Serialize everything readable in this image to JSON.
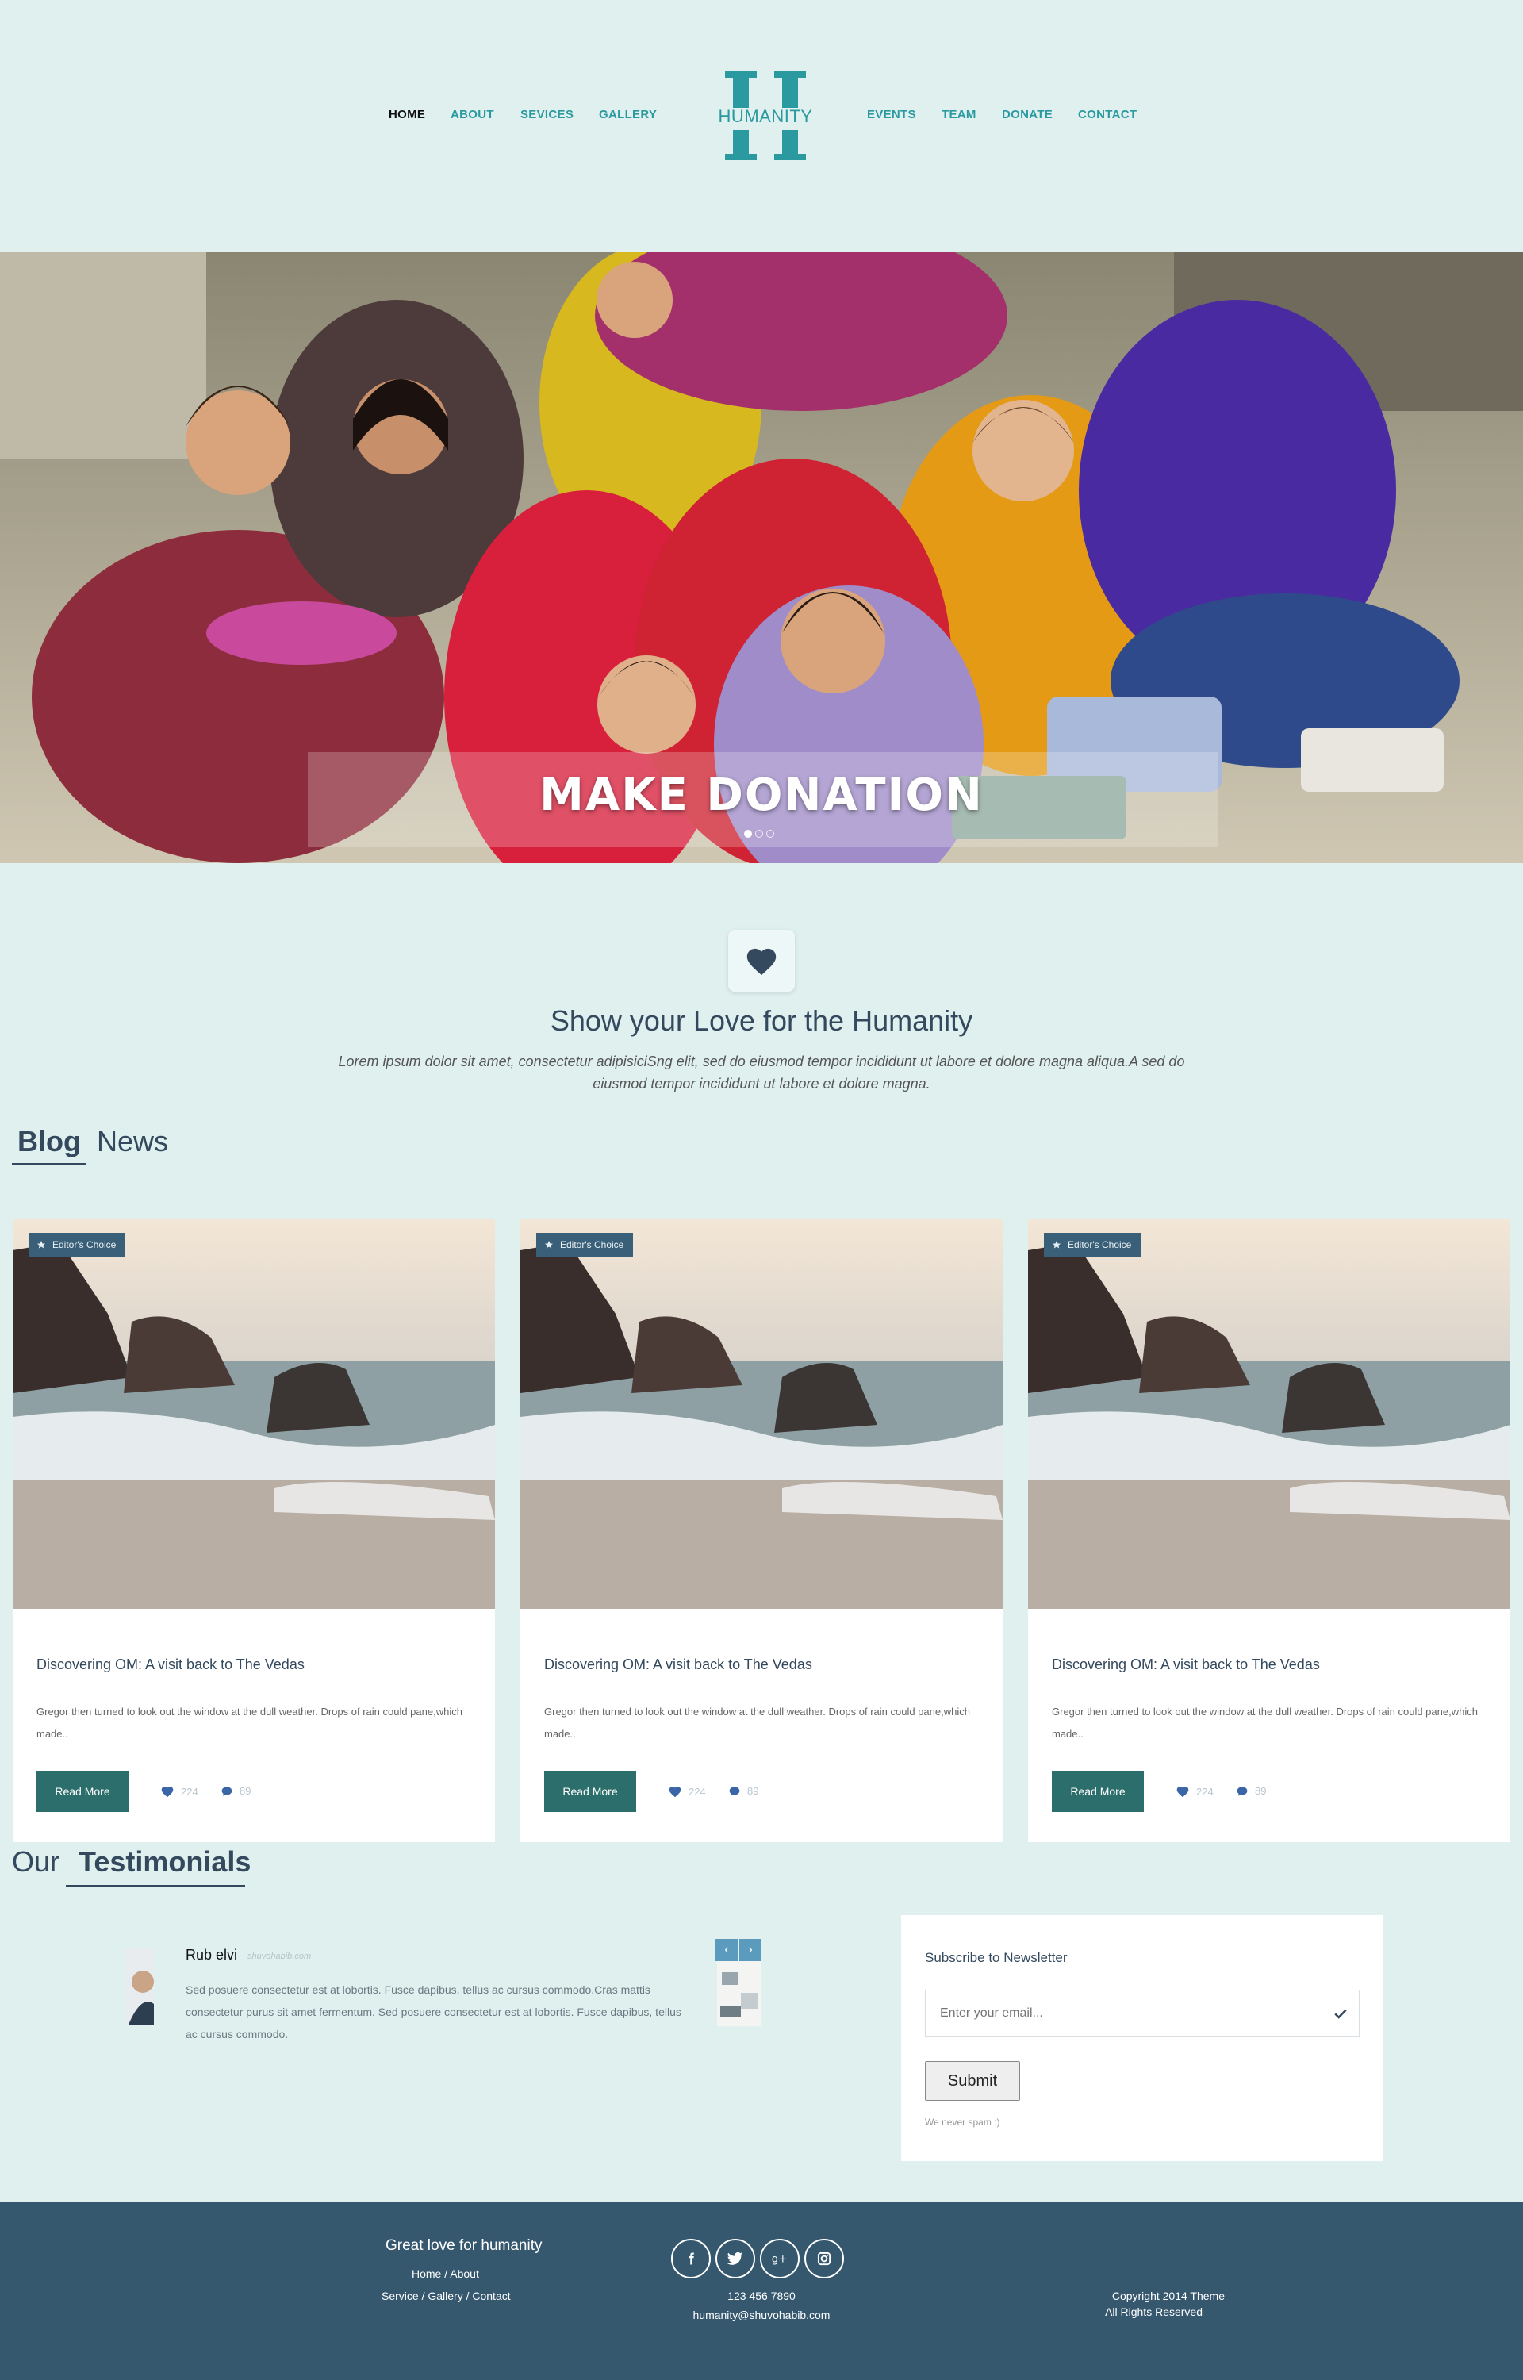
{
  "nav": {
    "left": [
      "HOME",
      "ABOUT",
      "SEVICES",
      "GALLERY"
    ],
    "right": [
      "EVENTS",
      "TEAM",
      "DONATE",
      "CONTACT"
    ],
    "logo_text": "HUMANITY"
  },
  "hero": {
    "title": "MAKE DONATION",
    "slides": 3,
    "active_slide": 1
  },
  "love": {
    "title": "Show your Love for the Humanity",
    "text": "Lorem ipsum dolor sit amet, consectetur adipisiciSng elit, sed do eiusmod tempor incididunt ut labore et dolore magna aliqua.A sed do eiusmod tempor incididunt ut labore et dolore magna."
  },
  "blog": {
    "title_bold": "Blog",
    "title_rest": "News",
    "cards": [
      {
        "badge": "Editor's Choice",
        "title": "Discovering OM: A visit back to The Vedas",
        "text": "Gregor then turned to look out the window at the dull weather. Drops of rain could pane,which made..",
        "button": "Read More",
        "likes": "224",
        "comments": "89"
      },
      {
        "badge": "Editor's Choice",
        "title": "Discovering OM: A visit back to The Vedas",
        "text": "Gregor then turned to look out the window at the dull weather. Drops of rain could pane,which made..",
        "button": "Read More",
        "likes": "224",
        "comments": "89"
      },
      {
        "badge": "Editor's Choice",
        "title": "Discovering OM: A visit back to The Vedas",
        "text": "Gregor then turned to look out the window at the dull weather. Drops of rain could pane,which made..",
        "button": "Read More",
        "likes": "224",
        "comments": "89"
      }
    ]
  },
  "testimonials": {
    "title_rest": "Our",
    "title_bold": "Testimonials",
    "name": "Rub elvi",
    "site": "shuvohabib.com",
    "text": "Sed posuere consectetur est at lobortis. Fusce dapibus, tellus ac cursus commodo.Cras mattis consectetur purus sit amet fermentum. Sed posuere consectetur est at lobortis. Fusce dapibus, tellus ac cursus commodo.",
    "prev": "‹",
    "next": "›"
  },
  "newsletter": {
    "title": "Subscribe to Newsletter",
    "placeholder": "Enter your email...",
    "submit": "Submit",
    "note": "We never spam :)"
  },
  "footer": {
    "heading": "Great love for humanity",
    "links1": "Home / About",
    "links2": "Service / Gallery / Contact",
    "social": [
      "facebook-icon",
      "twitter-icon",
      "google-plus-icon",
      "instagram-icon"
    ],
    "phone": "123 456 7890",
    "email": "humanity@shuvohabib.com",
    "copyright": "Copyright 2014 Theme",
    "rights": "All Rights Reserved"
  },
  "colors": {
    "background": "#dff0ef",
    "nav_link": "#2a9aa0",
    "primary_dark": "#34495e",
    "button": "#2c6e6b",
    "footer": "#36586f",
    "badge": "#3a5f78"
  }
}
